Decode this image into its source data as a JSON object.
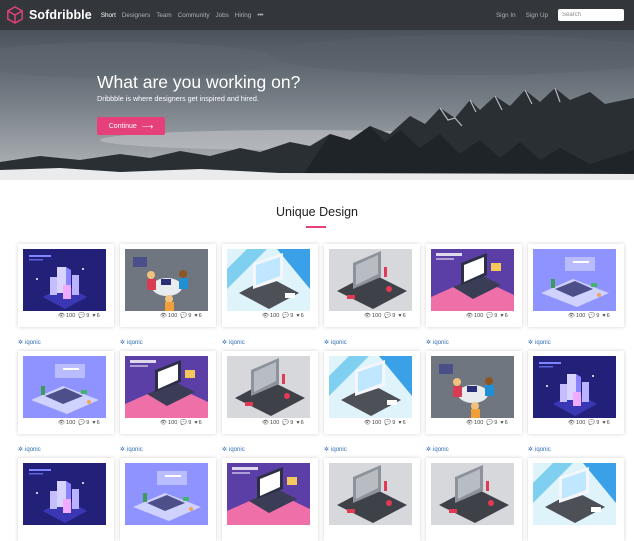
{
  "brand": {
    "name": "Sofdribble",
    "accent": "#e6407a"
  },
  "nav": {
    "links": [
      {
        "label": "Short",
        "active": true
      },
      {
        "label": "Designers"
      },
      {
        "label": "Team"
      },
      {
        "label": "Community"
      },
      {
        "label": "Jobs"
      },
      {
        "label": "Hiring"
      }
    ],
    "more": "•••",
    "sign_in": "Sign In",
    "sign_up": "Sign Up",
    "search_placeholder": "Search"
  },
  "hero": {
    "title": "What are you working on?",
    "subtitle": "Dribbble is where designers get inspired and hired.",
    "button": "Continue"
  },
  "section": {
    "title": "Unique Design"
  },
  "shots": [
    {
      "theme": "dark-city",
      "views": "100",
      "comments": "9",
      "likes": "6",
      "author": "iqonic"
    },
    {
      "theme": "gray-team",
      "views": "100",
      "comments": "9",
      "likes": "6",
      "author": "iqonic"
    },
    {
      "theme": "cyan-laptop",
      "views": "100",
      "comments": "9",
      "likes": "6",
      "author": "iqonic"
    },
    {
      "theme": "gray-laptop",
      "views": "100",
      "comments": "9",
      "likes": "6",
      "author": "iqonic"
    },
    {
      "theme": "purple-pink-desk",
      "views": "100",
      "comments": "9",
      "likes": "6",
      "author": "iqonic"
    },
    {
      "theme": "lavender-desk",
      "views": "100",
      "comments": "9",
      "likes": "6",
      "author": "iqonic"
    },
    {
      "theme": "lavender-desk",
      "views": "100",
      "comments": "9",
      "likes": "6",
      "author": "iqonic"
    },
    {
      "theme": "purple-pink-desk",
      "views": "100",
      "comments": "9",
      "likes": "6",
      "author": "iqonic"
    },
    {
      "theme": "gray-laptop",
      "views": "100",
      "comments": "9",
      "likes": "6",
      "author": "iqonic"
    },
    {
      "theme": "cyan-laptop",
      "views": "100",
      "comments": "9",
      "likes": "6",
      "author": "iqonic"
    },
    {
      "theme": "gray-team",
      "views": "100",
      "comments": "9",
      "likes": "6",
      "author": "iqonic"
    },
    {
      "theme": "dark-city",
      "views": "100",
      "comments": "9",
      "likes": "6",
      "author": "iqonic"
    },
    {
      "theme": "dark-city"
    },
    {
      "theme": "lavender-desk"
    },
    {
      "theme": "purple-pink-desk"
    },
    {
      "theme": "gray-laptop"
    },
    {
      "theme": "gray-laptop"
    },
    {
      "theme": "cyan-laptop"
    }
  ]
}
